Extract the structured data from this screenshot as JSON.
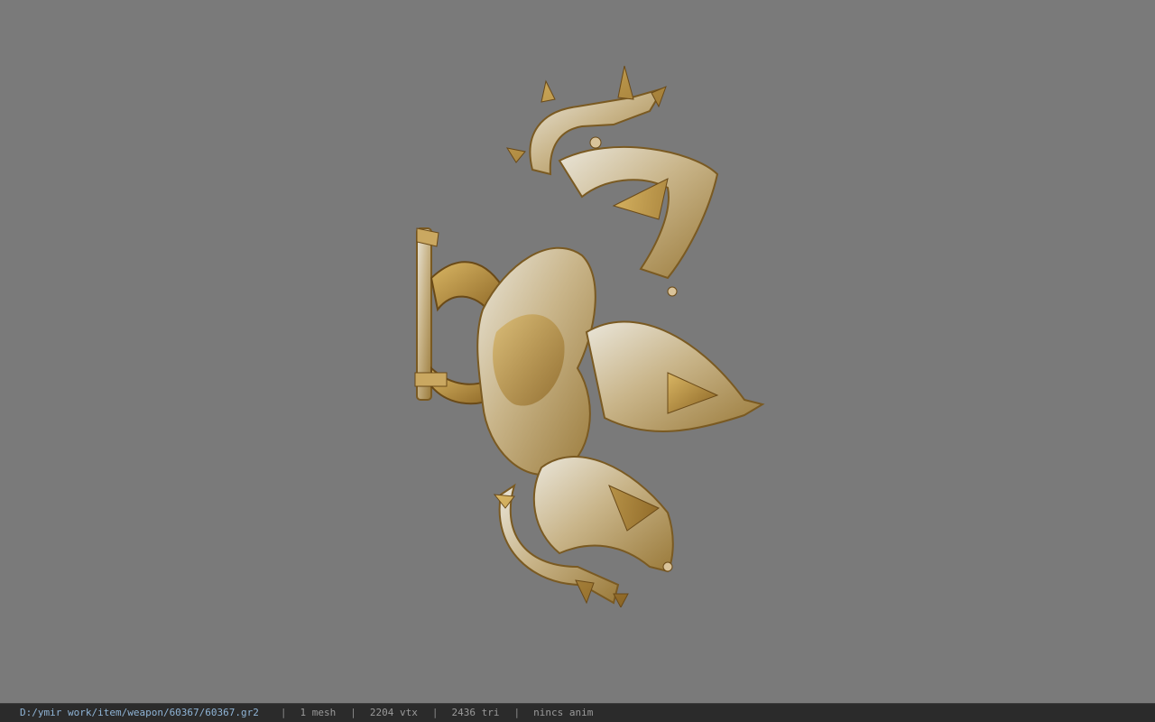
{
  "viewer": {
    "background_color": "#7a7a7a",
    "model_colors": {
      "gold": "#b8923e",
      "gold_dark": "#8a6a2a",
      "silver": "#d9d6cc",
      "silver_shadow": "#a9a396"
    }
  },
  "status_bar": {
    "file_path": "D:/ymir work/item/weapon/60367/60367.gr2",
    "mesh_count": "1 mesh",
    "vertex_count": "2204 vtx",
    "triangle_count": "2436 tri",
    "animation": "nincs anim",
    "separator": "|"
  }
}
